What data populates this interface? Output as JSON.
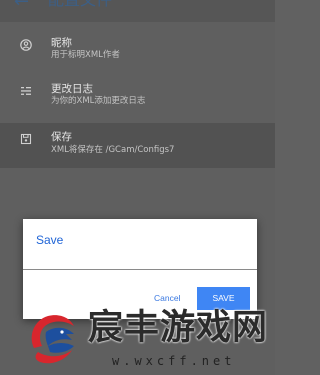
{
  "app_bar": {
    "title": "配置文件",
    "back_icon": "arrow-back-icon"
  },
  "settings": [
    {
      "title": "昵称",
      "subtitle": "用于标明XML作者",
      "icon": "account-circle-icon"
    },
    {
      "title": "更改日志",
      "subtitle": "为你的XML添加更改日志",
      "icon": "notes-icon"
    },
    {
      "title": "保存",
      "subtitle": "XML将保存在 /GCam/Configs7",
      "icon": "save-icon"
    }
  ],
  "dialog": {
    "title": "Save",
    "input_value": "",
    "cancel_label": "Cancel",
    "save_label": "SAVE"
  },
  "watermark": {
    "brand": "宸丰游戏网",
    "url": "w.wxcff.net"
  },
  "colors": {
    "accent": "#3f86f4",
    "dialog_title": "#1f64d6",
    "scrim": "#5f5f5f"
  }
}
